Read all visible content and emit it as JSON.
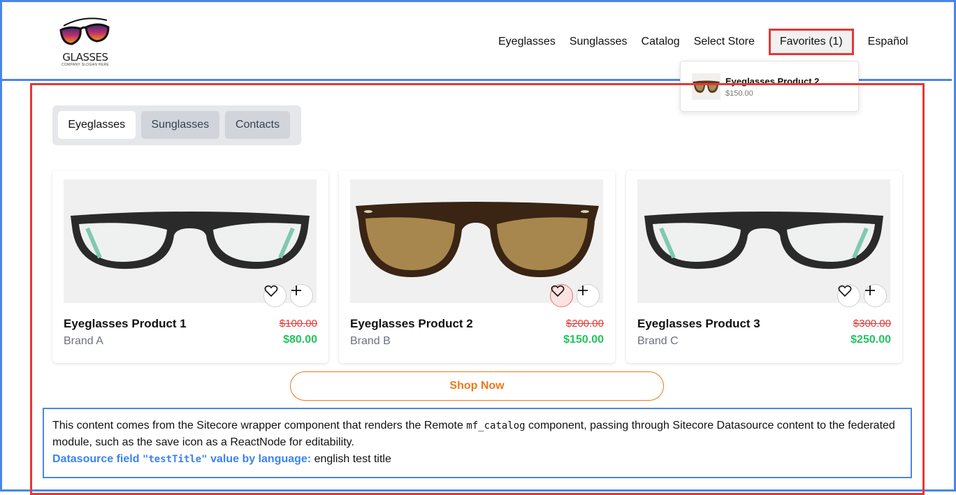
{
  "header": {
    "logo_text": "GLASSES",
    "logo_slogan": "COMPANY SLOGAN HERE",
    "nav": [
      "Eyeglasses",
      "Sunglasses",
      "Catalog",
      "Select Store"
    ],
    "favorites_label": "Favorites (1)",
    "language_label": "Español"
  },
  "favorites_dropdown": {
    "items": [
      {
        "name": "Eyeglasses Product 2",
        "price": "$150.00"
      }
    ]
  },
  "tabs": [
    {
      "label": "Eyeglasses",
      "active": true
    },
    {
      "label": "Sunglasses",
      "active": false
    },
    {
      "label": "Contacts",
      "active": false
    }
  ],
  "products": [
    {
      "title": "Eyeglasses Product 1",
      "brand": "Brand A",
      "old_price": "$100.00",
      "price": "$80.00",
      "favorited": false,
      "image": "clear-lens-glasses"
    },
    {
      "title": "Eyeglasses Product 2",
      "brand": "Brand B",
      "old_price": "$200.00",
      "price": "$150.00",
      "favorited": true,
      "image": "tinted-tortoise-glasses"
    },
    {
      "title": "Eyeglasses Product 3",
      "brand": "Brand C",
      "old_price": "$300.00",
      "price": "$250.00",
      "favorited": false,
      "image": "clear-lens-glasses"
    }
  ],
  "shop_now_label": "Shop Now",
  "info": {
    "text_before": "This content comes from the Sitecore wrapper component that renders the Remote ",
    "code": "mf_catalog",
    "text_after": " component, passing through Sitecore Datasource content to the federated module, such as the save icon as a ReactNode for editability.",
    "ds_label_before": "Datasource field ",
    "ds_field": "\"testTitle\"",
    "ds_label_after": " value by language:",
    "ds_value": " english test title"
  },
  "colors": {
    "outer_frame": "#4a86e8",
    "highlight": "#e53935",
    "price_new": "#22c55e",
    "shop_now": "#ea7a1c",
    "datasource_label": "#3b82f6"
  }
}
